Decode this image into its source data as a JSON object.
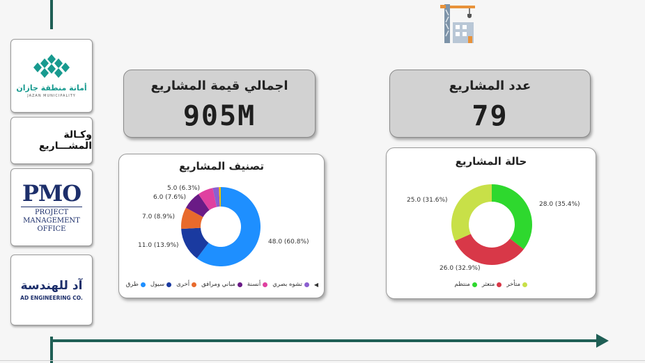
{
  "sidebar": {
    "logo1_arabic": "أمانة منطقة جازان",
    "logo1_english": "JAZAN MUNICIPALITY",
    "agency_label": "وكـالة المشـــاريع",
    "pmo": {
      "mark": "PMO",
      "line1": "PROJECT",
      "line2": "MANAGEMENT",
      "line3": "OFFICE"
    },
    "ad_logo": {
      "arabic": "آد للهندسة",
      "english": "AD ENGINEERING CO."
    }
  },
  "kpis": {
    "total_value": {
      "title": "اجمالي قيمة المشاريع",
      "value": "905M"
    },
    "project_count": {
      "title": "عدد المشاريع",
      "value": "79"
    }
  },
  "chart_data": [
    {
      "type": "pie",
      "title": "تصنيف المشاريع",
      "donut": true,
      "legend_position": "bottom",
      "series": [
        {
          "name": "طرق",
          "value": 48.0,
          "label": "48.0 (60.8%)",
          "color": "#1e8fff"
        },
        {
          "name": "سيول",
          "value": 11.0,
          "label": "11.0 (13.9%)",
          "color": "#1a3aa0"
        },
        {
          "name": "أخرى",
          "value": 7.0,
          "label": "7.0 (8.9%)",
          "color": "#e86a2c"
        },
        {
          "name": "مباني ومرافق",
          "value": 6.0,
          "label": "6.0 (7.6%)",
          "color": "#6a1b86"
        },
        {
          "name": "أنسنة",
          "value": 5.0,
          "label": "5.0 (6.3%)",
          "color": "#e040a0"
        },
        {
          "name": "تشوه بصري",
          "value": 2.0,
          "label": "",
          "color": "#8b5fd0"
        },
        {
          "name": "",
          "value": 0.6,
          "label": "",
          "color": "#f2c200"
        }
      ]
    },
    {
      "type": "pie",
      "title": "حالة المشاريع",
      "donut": true,
      "legend_position": "bottom",
      "series": [
        {
          "name": "منتظم",
          "value": 28.0,
          "label": "28.0 (35.4%)",
          "color": "#2ed82e"
        },
        {
          "name": "متعثر",
          "value": 26.0,
          "label": "26.0 (32.9%)",
          "color": "#d83848"
        },
        {
          "name": "متأخر",
          "value": 25.0,
          "label": "25.0 (31.6%)",
          "color": "#c8e048"
        }
      ]
    }
  ],
  "colors": {
    "accent": "#1f5f55",
    "kpi_bg": "#d2d2d2"
  },
  "icons": {
    "top": "construction-crane-icon",
    "arrow": "timeline-arrow"
  }
}
